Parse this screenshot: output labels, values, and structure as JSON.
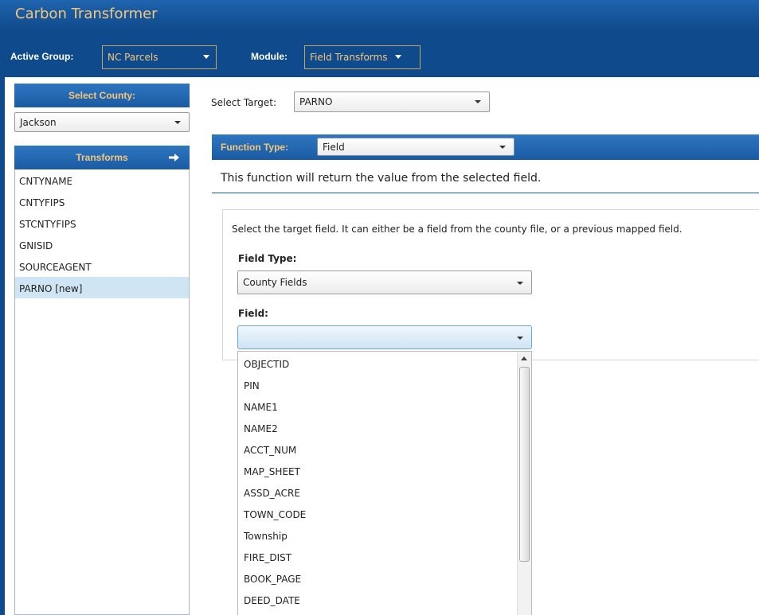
{
  "app": {
    "title": "Carbon Transformer"
  },
  "header": {
    "active_group_label": "Active Group:",
    "active_group_value": "NC Parcels",
    "module_label": "Module:",
    "module_value": "Field Transforms"
  },
  "sidebar": {
    "county_header": "Select County:",
    "county_value": "Jackson",
    "transforms_header": "Transforms",
    "items": [
      {
        "label": "CNTYNAME"
      },
      {
        "label": "CNTYFIPS"
      },
      {
        "label": "STCNTYFIPS"
      },
      {
        "label": "GNISID"
      },
      {
        "label": "SOURCEAGENT"
      },
      {
        "label": "PARNO [new]"
      }
    ]
  },
  "main": {
    "target_label": "Select Target:",
    "target_value": "PARNO",
    "function_type_label": "Function Type:",
    "function_type_value": "Field",
    "function_description": "This function will return the value from the selected field.",
    "field_hint": "Select the target field.  It can either be a field from the county file, or a previous mapped field.",
    "field_type_label": "Field Type:",
    "field_type_value": "County Fields",
    "field_label": "Field:",
    "field_value": "",
    "field_options": [
      "OBJECTID",
      "PIN",
      "NAME1",
      "NAME2",
      "ACCT_NUM",
      "MAP_SHEET",
      "ASSD_ACRE",
      "TOWN_CODE",
      "Township",
      "FIRE_DIST",
      "BOOK_PAGE",
      "DEED_DATE"
    ]
  },
  "colors": {
    "header_blue": "#0f4a8c",
    "accent_gold": "#f5c77a",
    "selected_row": "#cfe5f3"
  }
}
